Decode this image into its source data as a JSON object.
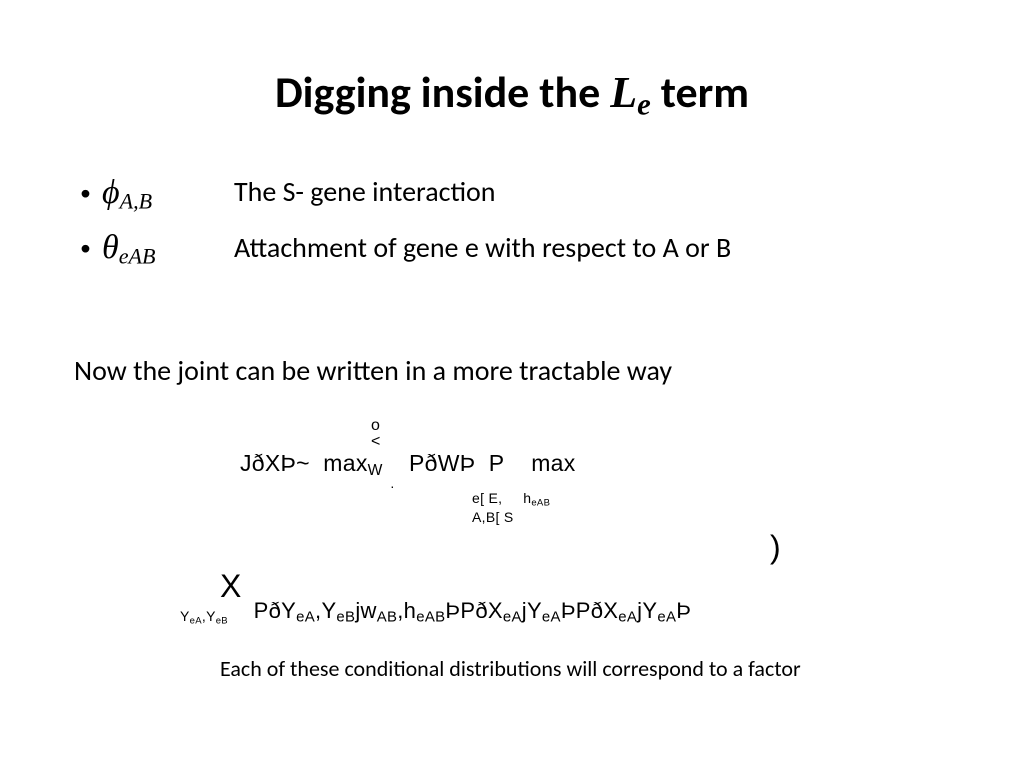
{
  "title": {
    "pre": "Digging inside the ",
    "L": "L",
    "sub": "e",
    "post": " term"
  },
  "bullets": [
    {
      "symbol_base": "ϕ",
      "symbol_sub": "A,B",
      "text": "The S- gene interaction"
    },
    {
      "symbol_base": "θ",
      "symbol_sub": "eAB",
      "text": "Attachment of gene e with respect to A or B"
    }
  ],
  "body_line": "Now the joint can be written in a more tractable way",
  "formula": {
    "pre_stack_top": "o",
    "pre_stack_mid": "<",
    "line1_left": "JðXÞ~",
    "line1_max1": "max",
    "line1_max1_sub": "W",
    "stack_dot": ".",
    "line1_mid": "PðWÞ",
    "line1_prod": "P",
    "line1_max2": "max",
    "sub_block_1": "e[ E,",
    "sub_block_1b": "h",
    "sub_block_1b_sub": "eAB",
    "sub_block_2": "A,B[ S",
    "paren": ")",
    "big_x": "X",
    "row2": "PðYeA,YeBjwAB,heABÞPðXeAjYeAÞPðXeAjYeAÞ",
    "row2_sub": "YeA,YeB"
  },
  "caption": "Each of these conditional distributions will correspond to a factor"
}
